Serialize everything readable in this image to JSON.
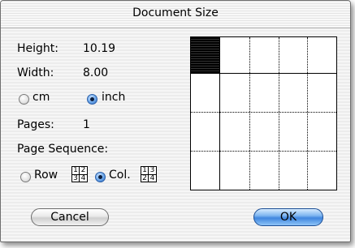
{
  "dialog": {
    "title": "Document Size"
  },
  "fields": {
    "height_label": "Height:",
    "height_value": "10.19",
    "width_label": "Width:",
    "width_value": "8.00",
    "pages_label": "Pages:",
    "pages_value": "1"
  },
  "units": {
    "cm_label": "cm",
    "inch_label": "inch",
    "selected": "inch"
  },
  "sequence": {
    "label": "Page Sequence:",
    "row_label": "Row",
    "col_label": "Col.",
    "row_order": [
      "1",
      "2",
      "3",
      "4"
    ],
    "col_order": [
      "1",
      "3",
      "2",
      "4"
    ],
    "selected": "Col."
  },
  "buttons": {
    "cancel": "Cancel",
    "ok": "OK"
  },
  "colors": {
    "accent": "#3f86df"
  }
}
